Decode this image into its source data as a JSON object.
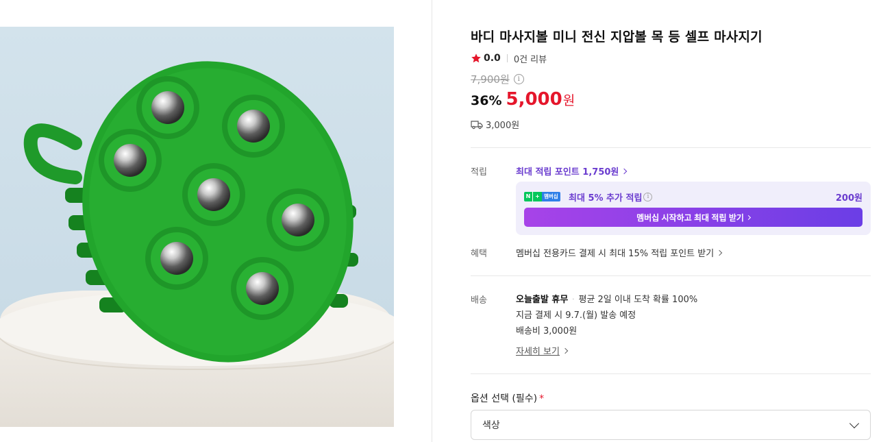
{
  "product": {
    "title": "바디 마사지볼 미니 전신 지압볼 목 등 셀프 마사지기",
    "rating": "0.0",
    "review_count": "0건 리뷰",
    "original_price": "7,900원",
    "discount": "36%",
    "sale_price": "5,000",
    "sale_unit": "원",
    "shipping_fee": "3,000원",
    "star_color": "#e5162b"
  },
  "points": {
    "label": "적립",
    "link_text": "최대 적립 포인트 1,750원",
    "membership_badge": {
      "n": "N",
      "plus": "+",
      "text": "멤버십"
    },
    "membership_text": "최대 5% 추가 적립",
    "membership_amount": "200원",
    "membership_button": "멤버십 시작하고 최대 적립 받기"
  },
  "benefit": {
    "label": "혜택",
    "text": "멤버십 전용카드 결제 시 최대 15% 적립 포인트 받기"
  },
  "delivery": {
    "label": "배송",
    "type": "오늘출발 휴무",
    "dot": "·",
    "arrival": "평균 2일 이내 도착 확률 100%",
    "dispatch": "지금 결제 시 9.7.(월) 발송 예정",
    "fee": "배송비 3,000원",
    "detail_link": "자세히 보기"
  },
  "option": {
    "label": "옵션 선택 (필수)",
    "required_mark": "*",
    "placeholder": "색상"
  },
  "colors": {
    "accent_purple": "#6a3ccf",
    "price_red": "#e5162b",
    "product_green": "#1f9a2a"
  }
}
